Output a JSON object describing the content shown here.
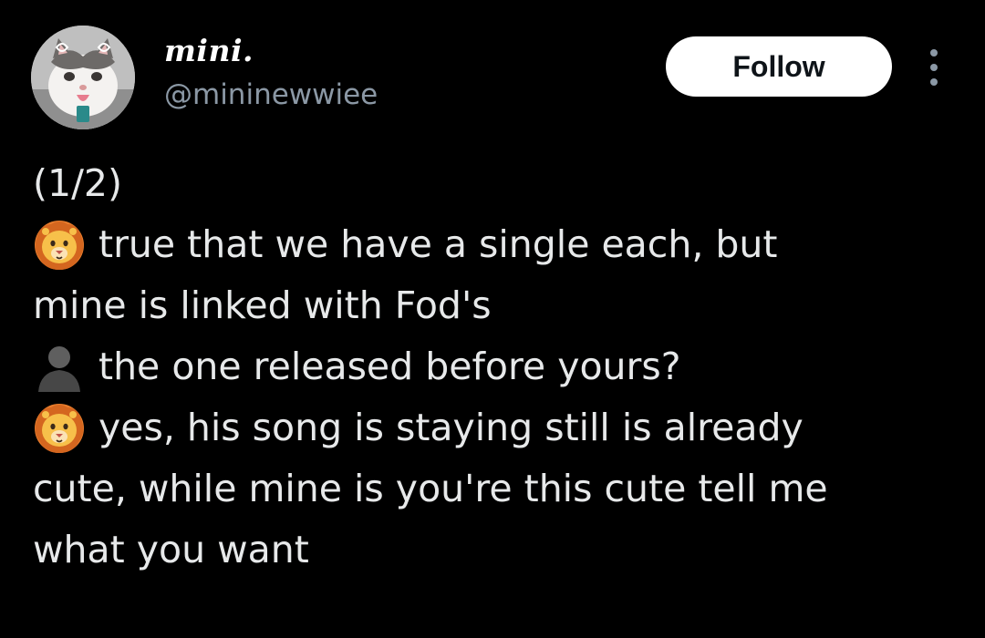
{
  "author": {
    "display_name": "mini.",
    "handle": "@mininewwiee",
    "avatar_icon": "cat-avatar-icon"
  },
  "actions": {
    "follow_label": "Follow",
    "more_icon": "more-options-icon"
  },
  "tweet": {
    "lines": [
      {
        "emoji": null,
        "text": "(1/2)"
      },
      {
        "emoji": "lion-face-icon",
        "text": "true that we have a single each, but"
      },
      {
        "emoji": null,
        "text": "mine is linked with Fod's"
      },
      {
        "emoji": "bust-silhouette-icon",
        "text": "the one released before yours?"
      },
      {
        "emoji": "lion-face-icon",
        "text": "yes, his song is staying still is already"
      },
      {
        "emoji": null,
        "text": "cute, while mine is you're this cute tell me"
      },
      {
        "emoji": null,
        "text": "what you want"
      }
    ]
  },
  "colors": {
    "background": "#000000",
    "text_primary": "#e7e9ea",
    "text_secondary": "#8b98a5",
    "follow_bg": "#ffffff",
    "follow_text": "#0f1419"
  }
}
